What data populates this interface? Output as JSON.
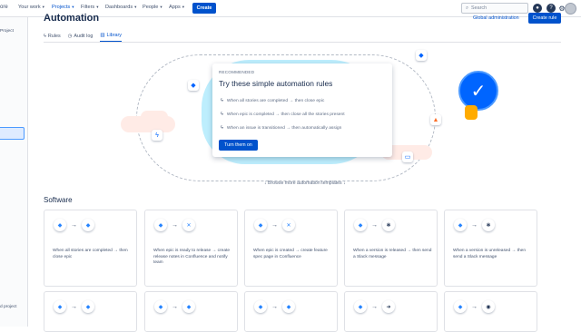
{
  "topbar": {
    "logo_text": "ore",
    "nav": [
      {
        "label": "Your work"
      },
      {
        "label": "Projects"
      },
      {
        "label": "Filters"
      },
      {
        "label": "Dashboards"
      },
      {
        "label": "People"
      },
      {
        "label": "Apps"
      }
    ],
    "create_label": "Create",
    "search_placeholder": "Search"
  },
  "sidebar": {
    "project_text": "Project",
    "bottom_text": "d project"
  },
  "page": {
    "title": "Automation",
    "global_admin": "Global administration",
    "create_rule": "Create rule",
    "tabs": [
      {
        "label": "Rules"
      },
      {
        "label": "Audit log"
      },
      {
        "label": "Library"
      }
    ]
  },
  "recommend": {
    "eyebrow": "RECOMMENDED",
    "title": "Try these simple automation rules",
    "rules": [
      "When all stories are completed → then close epic",
      "When epic is completed → then close all the stories present",
      "When an issue is transitioned → then automatically assign"
    ],
    "button": "Turn them on"
  },
  "browse_label": "↓ Browse more automation templates ↓",
  "section_title": "Software",
  "templates": [
    {
      "desc": "When all stories are completed → then close epic",
      "from_icon": "jira-diamond",
      "to_icon": "jira-diamond"
    },
    {
      "desc": "When epic is ready to release → create release notes in Confluence and notify team",
      "from_icon": "jira-diamond",
      "to_icon": "confluence-icon"
    },
    {
      "desc": "When epic is created → create feature spec page in Confluence",
      "from_icon": "jira-diamond",
      "to_icon": "confluence-icon"
    },
    {
      "desc": "When a version is released → then send a Slack message",
      "from_icon": "jira-diamond",
      "to_icon": "slack-icon"
    },
    {
      "desc": "When a version is unreleased → then send a Slack message",
      "from_icon": "jira-diamond",
      "to_icon": "slack-icon"
    }
  ],
  "colors": {
    "primary": "#0052cc",
    "blob": "#bdeefd",
    "cloud": "#ffebe6"
  }
}
